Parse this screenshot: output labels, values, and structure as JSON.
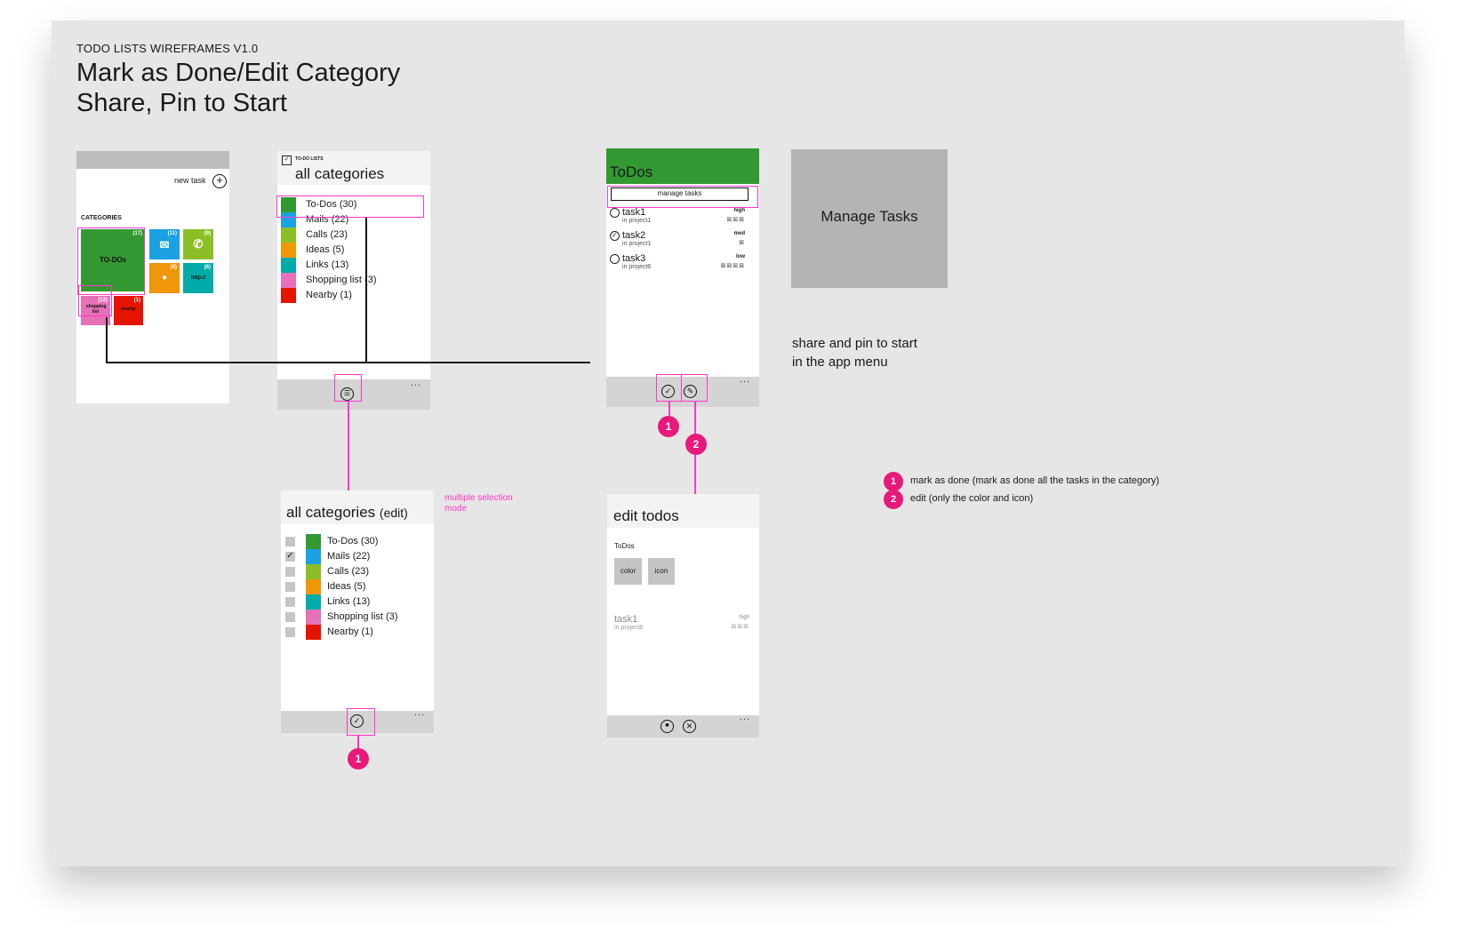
{
  "header": {
    "subtitle": "TODO LISTS WIREFRAMES V1.0",
    "title_line1": "Mark as Done/Edit Category",
    "title_line2": "Share, Pin to Start"
  },
  "start_screen": {
    "new_task_label": "new task",
    "categories_heading": "CATEGORIES",
    "tiles": [
      {
        "label": "TO-DOs",
        "count": "(17)",
        "color": "#339933"
      },
      {
        "label": "",
        "count": "(11)",
        "color": "#1ba1e2",
        "icon": "mail-icon"
      },
      {
        "label": "",
        "count": "(9)",
        "color": "#8cbf26",
        "icon": "phone-icon"
      },
      {
        "label": "",
        "count": "(8)",
        "color": "#f09609",
        "icon": "lightbulb-icon"
      },
      {
        "label": "http://",
        "count": "(6)",
        "color": "#00aba9"
      },
      {
        "label": "shopping list",
        "count": "(12)",
        "color": "#e671b8"
      },
      {
        "label": "nearby",
        "count": "(1)",
        "color": "#e51400"
      }
    ]
  },
  "categories_screen": {
    "app_label": "TO-DO LISTS",
    "title": "all categories",
    "items": [
      {
        "label": "To-Dos (30)",
        "color": "#339933"
      },
      {
        "label": "Mails (22)",
        "color": "#1ba1e2"
      },
      {
        "label": "Calls (23)",
        "color": "#8cbf26"
      },
      {
        "label": "Ideas (5)",
        "color": "#f09609"
      },
      {
        "label": "Links (13)",
        "color": "#00aba9"
      },
      {
        "label": "Shopping list (3)",
        "color": "#e671b8"
      },
      {
        "label": "Nearby (1)",
        "color": "#e51400"
      }
    ],
    "more_label": "..."
  },
  "edit_categories_screen": {
    "title": "all categories",
    "title_suffix": "(edit)",
    "note": "multiple selection mode",
    "items": [
      {
        "label": "To-Dos (30)",
        "color": "#339933",
        "checked": false
      },
      {
        "label": "Mails (22)",
        "color": "#1ba1e2",
        "checked": true
      },
      {
        "label": "Calls (23)",
        "color": "#8cbf26",
        "checked": false
      },
      {
        "label": "Ideas (5)",
        "color": "#f09609",
        "checked": false
      },
      {
        "label": "Links (13)",
        "color": "#00aba9",
        "checked": false
      },
      {
        "label": "Shopping list (3)",
        "color": "#e671b8",
        "checked": false
      },
      {
        "label": "Nearby (1)",
        "color": "#e51400",
        "checked": false
      }
    ],
    "more_label": "...",
    "badge": "1"
  },
  "todos_screen": {
    "title": "ToDos",
    "manage_button": "manage tasks",
    "tasks": [
      {
        "name": "task1",
        "project": "in project1",
        "priority": "high",
        "icons": "⊠⊠⊠",
        "done": false
      },
      {
        "name": "task2",
        "project": "in project1",
        "priority": "med",
        "icons": "⊠",
        "done": true
      },
      {
        "name": "task3",
        "project": "in project6",
        "priority": "low",
        "icons": "⊠⊠⊠⊠",
        "done": false
      }
    ],
    "more_label": "...",
    "badge1": "1",
    "badge2": "2",
    "header_color": "#339933"
  },
  "manage_tasks_box": {
    "label": "Manage Tasks"
  },
  "share_note": {
    "line1": "share and pin to start",
    "line2": "in the app menu"
  },
  "edit_todos_screen": {
    "title": "edit todos",
    "category_name": "ToDos",
    "color_button": "color",
    "icon_button": "icon",
    "task_name": "task1",
    "task_project": "in project6",
    "task_priority": "high",
    "task_icons": "⊠⊠⊠",
    "more_label": "..."
  },
  "legend": [
    {
      "num": "1",
      "text": "mark as done (mark as done all the tasks in the category)"
    },
    {
      "num": "2",
      "text": "edit (only the color and icon)"
    }
  ],
  "accent_pink": "#ff37c8",
  "badge_color": "#e8197a"
}
